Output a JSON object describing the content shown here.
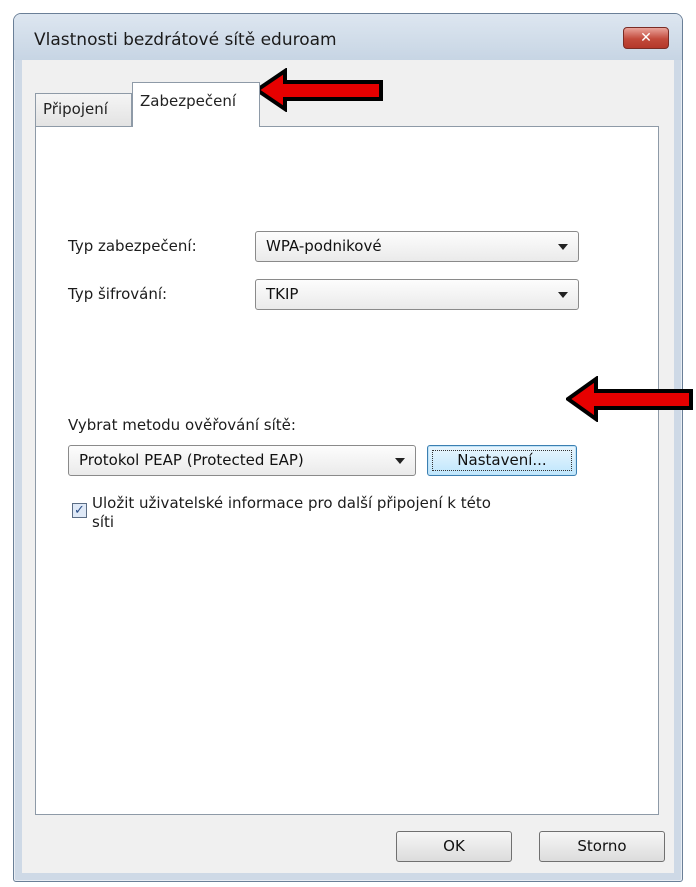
{
  "window": {
    "title": "Vlastnosti bezdrátové sítě eduroam",
    "close_glyph": "✕"
  },
  "tabs": [
    {
      "label": "Připojení",
      "selected": false
    },
    {
      "label": "Zabezpečení",
      "selected": true
    }
  ],
  "security": {
    "security_type_label": "Typ zabezpečení:",
    "security_type_value": "WPA-podnikové",
    "encryption_type_label": "Typ šifrování:",
    "encryption_type_value": "TKIP",
    "auth_method_label": "Vybrat metodu ověřování sítě:",
    "auth_method_value": "Protokol PEAP (Protected EAP)",
    "settings_button": "Nastavení...",
    "remember_checkbox_label_line1": "Uložit uživatelské informace pro další připojení k této",
    "remember_checkbox_label_line2": "síti",
    "remember_checked": true
  },
  "footer": {
    "ok_label": "OK",
    "cancel_label": "Storno"
  },
  "colors": {
    "annotation_arrow": "#e60000",
    "close_button": "#c24a3b"
  }
}
